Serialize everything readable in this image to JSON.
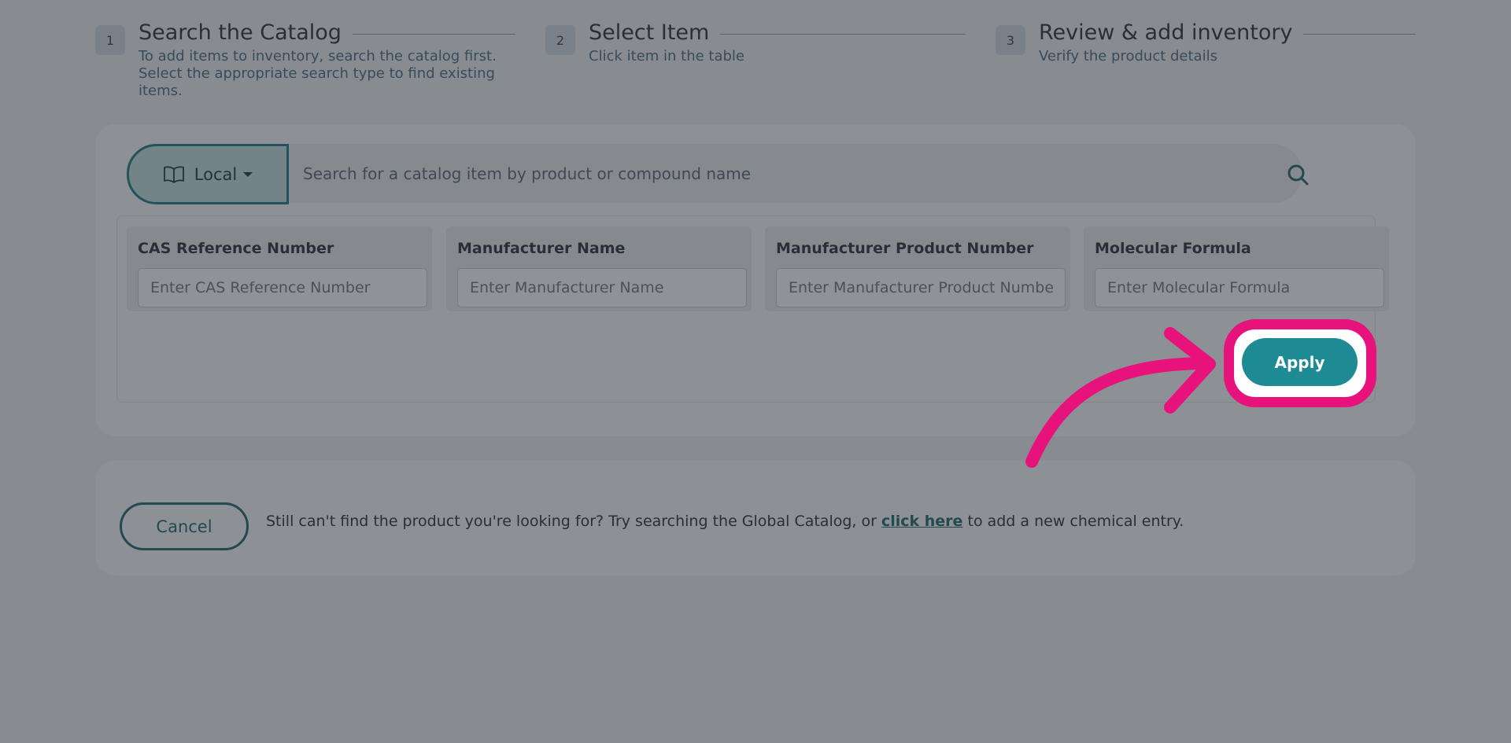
{
  "steps": [
    {
      "number": "1",
      "title": "Search the Catalog",
      "description": "To add items to inventory, search the catalog first. Select the appropriate search type to find existing items."
    },
    {
      "number": "2",
      "title": "Select Item",
      "description": "Click item in the table"
    },
    {
      "number": "3",
      "title": "Review & add inventory",
      "description": "Verify the product details"
    }
  ],
  "search": {
    "scope_label": "Local",
    "placeholder": "Search for a catalog item by product or compound name",
    "value": ""
  },
  "filters": [
    {
      "label": "CAS Reference Number",
      "placeholder": "Enter CAS Reference Number",
      "value": ""
    },
    {
      "label": "Manufacturer Name",
      "placeholder": "Enter Manufacturer Name",
      "value": ""
    },
    {
      "label": "Manufacturer Product Number",
      "placeholder": "Enter Manufacturer Product Number",
      "value": ""
    },
    {
      "label": "Molecular Formula",
      "placeholder": "Enter Molecular Formula",
      "value": ""
    }
  ],
  "apply_label": "Apply",
  "footer": {
    "cancel_label": "Cancel",
    "help_prefix": "Still can't find the product you're looking for? Try searching the Global Catalog, or ",
    "help_link": "click here",
    "help_suffix": " to add a new chemical entry."
  },
  "colors": {
    "accent": "#1e8a93",
    "highlight": "#e8127c",
    "overlay": "rgba(40,46,54,0.52)"
  },
  "icons": {
    "scope": "book-icon",
    "search": "search-icon",
    "caret": "caret-down-icon"
  }
}
